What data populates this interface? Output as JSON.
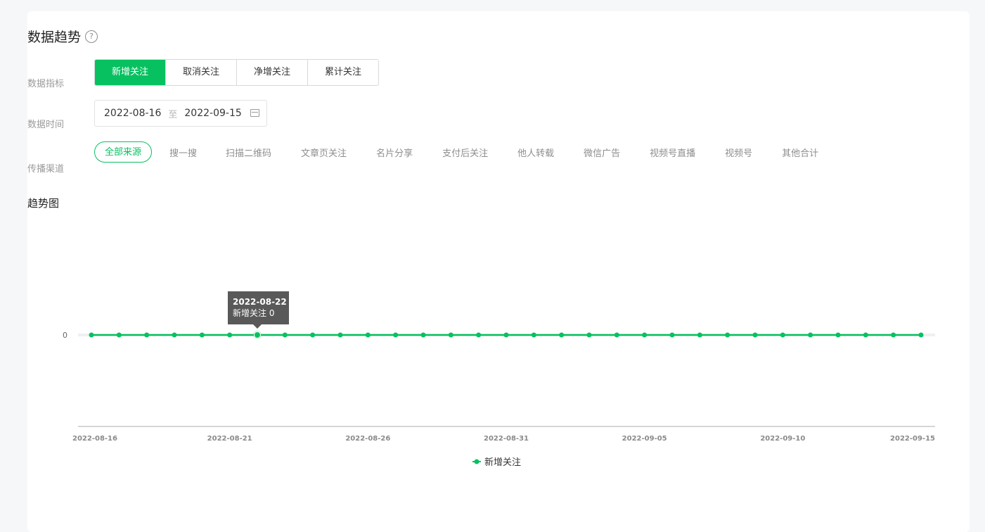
{
  "header": {
    "title": "数据趋势",
    "help_icon": "help-circle-icon"
  },
  "metric": {
    "label": "数据指标",
    "options": [
      "新增关注",
      "取消关注",
      "净增关注",
      "累计关注"
    ],
    "selected": "新增关注"
  },
  "date": {
    "label": "数据时间",
    "start": "2022-08-16",
    "separator": "至",
    "end": "2022-09-15",
    "icon": "calendar-icon"
  },
  "channel": {
    "label": "传播渠道",
    "options": [
      "全部来源",
      "搜一搜",
      "扫描二维码",
      "文章页关注",
      "名片分享",
      "支付后关注",
      "他人转载",
      "微信广告",
      "视频号直播",
      "视频号",
      "其他合计"
    ],
    "selected": "全部来源"
  },
  "chart_section": {
    "title": "趋势图"
  },
  "colors": {
    "accent": "#07c160",
    "tooltip_bg": "#595959"
  },
  "chart_data": {
    "type": "line",
    "x": [
      "2022-08-16",
      "2022-08-17",
      "2022-08-18",
      "2022-08-19",
      "2022-08-20",
      "2022-08-21",
      "2022-08-22",
      "2022-08-23",
      "2022-08-24",
      "2022-08-25",
      "2022-08-26",
      "2022-08-27",
      "2022-08-28",
      "2022-08-29",
      "2022-08-30",
      "2022-08-31",
      "2022-09-01",
      "2022-09-02",
      "2022-09-03",
      "2022-09-04",
      "2022-09-05",
      "2022-09-06",
      "2022-09-07",
      "2022-09-08",
      "2022-09-09",
      "2022-09-10",
      "2022-09-11",
      "2022-09-12",
      "2022-09-13",
      "2022-09-14",
      "2022-09-15"
    ],
    "x_ticks": [
      "2022-08-16",
      "2022-08-21",
      "2022-08-26",
      "2022-08-31",
      "2022-09-05",
      "2022-09-10",
      "2022-09-15"
    ],
    "y_ticks": [
      "0"
    ],
    "series": [
      {
        "name": "新增关注",
        "values": [
          0,
          0,
          0,
          0,
          0,
          0,
          0,
          0,
          0,
          0,
          0,
          0,
          0,
          0,
          0,
          0,
          0,
          0,
          0,
          0,
          0,
          0,
          0,
          0,
          0,
          0,
          0,
          0,
          0,
          0,
          0
        ]
      }
    ],
    "tooltip": {
      "date": "2022-08-22",
      "series": "新增关注",
      "value": "0"
    },
    "legend": "bottom-center"
  }
}
